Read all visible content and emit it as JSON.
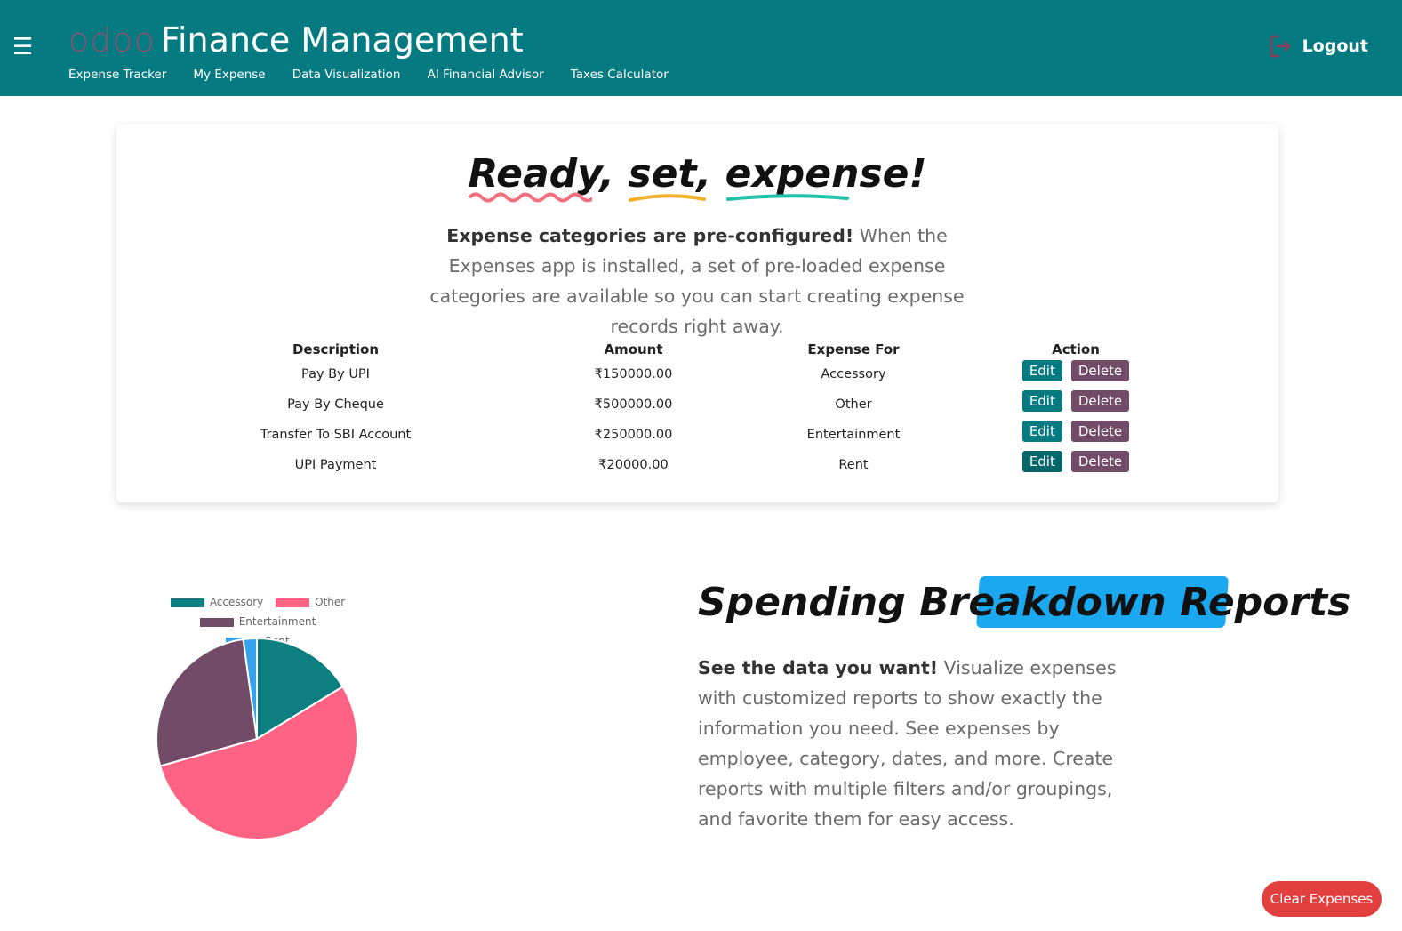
{
  "header": {
    "menu_icon": "hamburger-icon",
    "logo": "odoo",
    "title": "Finance Management",
    "nav": [
      "Expense Tracker",
      "My Expense",
      "Data Visualization",
      "AI Financial Advisor",
      "Taxes Calculator"
    ],
    "logout_label": "Logout",
    "logout_icon": "logout-icon"
  },
  "hero": {
    "title_words": [
      "Ready,",
      "set,",
      "expense!"
    ],
    "desc_bold": "Expense categories are pre-configured!",
    "desc_rest": " When the Expenses app is installed, a set of pre-loaded expense categories are available so you can start creating expense records right away."
  },
  "table": {
    "headers": [
      "Description",
      "Amount",
      "Expense For",
      "Action"
    ],
    "rows": [
      {
        "description": "Pay By UPI",
        "amount": "₹150000.00",
        "expense_for": "Accessory"
      },
      {
        "description": "Pay By Cheque",
        "amount": "₹500000.00",
        "expense_for": "Other"
      },
      {
        "description": "Transfer To SBI Account",
        "amount": "₹250000.00",
        "expense_for": "Entertainment"
      },
      {
        "description": "UPI Payment",
        "amount": "₹20000.00",
        "expense_for": "Rent"
      }
    ],
    "edit_label": "Edit",
    "delete_label": "Delete"
  },
  "chart_data": {
    "type": "pie",
    "categories": [
      "Accessory",
      "Other",
      "Entertainment",
      "Rent"
    ],
    "values": [
      150000,
      500000,
      250000,
      20000
    ],
    "colors": [
      "#0e7f80",
      "#ff6384",
      "#714b67",
      "#36a2eb"
    ],
    "legend": "top"
  },
  "report": {
    "title_plain": "Spending ",
    "title_highlight": "Breakdown Reports",
    "desc_bold": "See the data you want!",
    "desc_rest": " Visualize expenses with customized reports to show exactly the information you need. See expenses by employee, category, dates, and more. Create reports with multiple filters and/or groupings, and favorite them for easy access."
  },
  "clear_button": "Clear Expenses",
  "colors": {
    "header_bg": "#057a80",
    "edit_button": "#057a80",
    "delete_button": "#714b67",
    "clear_button": "#e2403f",
    "highlight": "#1aa9f0"
  }
}
